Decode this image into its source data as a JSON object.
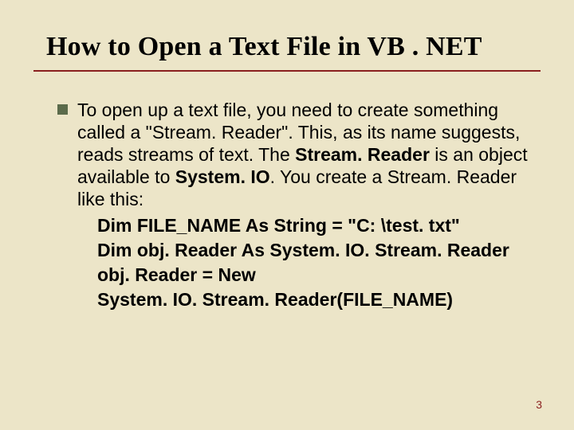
{
  "title": "How to Open a Text File in VB . NET",
  "bullet_text_1": "To open up a text file, you need to create something called a \"Stream. Reader\". This, as its name suggests, reads streams of text. The ",
  "bullet_bold_1": "Stream. Reader",
  "bullet_text_2": " is an object available to ",
  "bullet_bold_2": "System. IO",
  "bullet_text_3": ". You create a Stream. Reader like this:",
  "code": {
    "line1": "Dim FILE_NAME As String = \"C: \\test. txt\"",
    "line2": "Dim obj. Reader As System. IO. Stream. Reader",
    "line3": "obj. Reader = New",
    "line4": "System. IO. Stream. Reader(FILE_NAME)"
  },
  "page_number": "3"
}
